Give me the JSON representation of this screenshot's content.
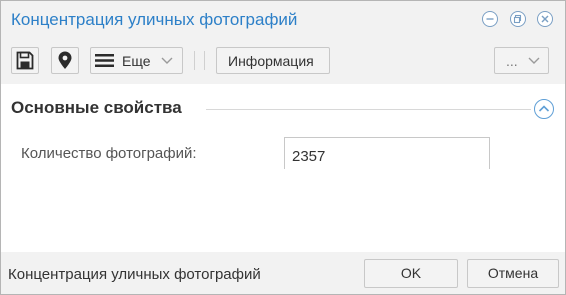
{
  "window": {
    "title": "Концентрация уличных фотографий"
  },
  "controls": {
    "minimize_icon": "minimize-icon",
    "restore_icon": "restore-icon",
    "close_icon": "close-icon"
  },
  "toolbar": {
    "save_icon": "save-icon",
    "location_icon": "map-pin-icon",
    "more_label": "Еще",
    "info_label": "Информация",
    "overflow_label": "..."
  },
  "section": {
    "title": "Основные свойства",
    "collapse_icon": "chevron-up-icon"
  },
  "fields": {
    "photo_count": {
      "label": "Количество фотографий:",
      "value": "2357"
    }
  },
  "footer": {
    "text": "Концентрация уличных фотографий",
    "ok_label": "OK",
    "cancel_label": "Отмена"
  },
  "colors": {
    "accent": "#2d80c8",
    "icon_dark": "#2b2b2b",
    "panel_bg": "#f2f2f2"
  }
}
